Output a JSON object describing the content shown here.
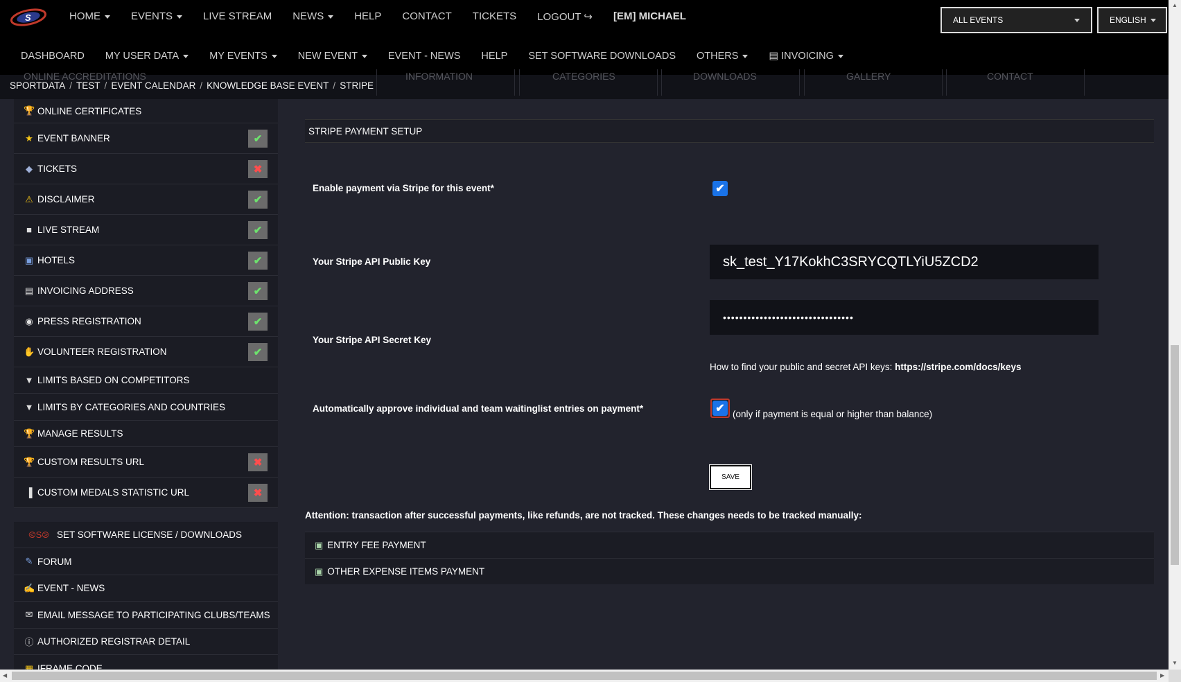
{
  "topnav": {
    "items": [
      "HOME",
      "EVENTS",
      "LIVE STREAM",
      "NEWS",
      "HELP",
      "CONTACT",
      "TICKETS",
      "LOGOUT"
    ],
    "user": "[EM] MICHAEL",
    "event_select": "ALL EVENTS",
    "language_select": "ENGLISH"
  },
  "subnav": {
    "items": [
      "DASHBOARD",
      "MY USER DATA",
      "MY EVENTS",
      "NEW EVENT",
      "EVENT - NEWS",
      "HELP",
      "SET SOFTWARE DOWNLOADS",
      "OTHERS",
      "INVOICING"
    ]
  },
  "ghost_tabs": [
    "ONLINE ACCREDITATIONS",
    "INFORMATION",
    "CATEGORIES",
    "DOWNLOADS",
    "GALLERY",
    "CONTACT"
  ],
  "breadcrumb": [
    "SPORTDATA",
    "TEST",
    "EVENT CALENDAR",
    "KNOWLEDGE BASE EVENT",
    "STRIPE"
  ],
  "sidebar": {
    "items": [
      {
        "label": "ONLINE CERTIFICATES",
        "icon": "trophy-icon",
        "status": ""
      },
      {
        "label": "EVENT BANNER",
        "icon": "star-icon",
        "status": "ok"
      },
      {
        "label": "TICKETS",
        "icon": "tag-icon",
        "status": "missing"
      },
      {
        "label": "DISCLAIMER",
        "icon": "warning-icon",
        "status": "ok"
      },
      {
        "label": "LIVE STREAM",
        "icon": "video-icon",
        "status": "ok"
      },
      {
        "label": "HOTELS",
        "icon": "suitcase-icon",
        "status": "ok"
      },
      {
        "label": "INVOICING ADDRESS",
        "icon": "document-icon",
        "status": "ok"
      },
      {
        "label": "PRESS REGISTRATION",
        "icon": "camera-icon",
        "status": "ok"
      },
      {
        "label": "VOLUNTEER REGISTRATION",
        "icon": "hand-icon",
        "status": "ok"
      },
      {
        "label": "LIMITS BASED ON COMPETITORS",
        "icon": "filter-icon",
        "status": ""
      },
      {
        "label": "LIMITS BY CATEGORIES AND COUNTRIES",
        "icon": "filter-icon",
        "status": ""
      },
      {
        "label": "MANAGE RESULTS",
        "icon": "trophy-icon",
        "status": ""
      },
      {
        "label": "CUSTOM RESULTS URL",
        "icon": "trophy-icon",
        "status": "missing"
      },
      {
        "label": "CUSTOM MEDALS STATISTIC URL",
        "icon": "bar-chart-icon",
        "status": "missing"
      }
    ],
    "items2": [
      {
        "label": "SET SOFTWARE LICENSE / DOWNLOADS",
        "icon": "sportdata-logo-icon"
      },
      {
        "label": "FORUM",
        "icon": "forum-icon"
      },
      {
        "label": "EVENT - NEWS",
        "icon": "news-icon"
      },
      {
        "label": "EMAIL MESSAGE TO PARTICIPATING CLUBS/TEAMS",
        "icon": "envelope-icon"
      },
      {
        "label": "AUTHORIZED REGISTRAR DETAIL",
        "icon": "info-icon"
      },
      {
        "label": "IFRAME CODE",
        "icon": "code-icon"
      }
    ]
  },
  "stripe": {
    "header": "STRIPE PAYMENT SETUP",
    "enable_label": "Enable payment via Stripe for this event*",
    "enable_checked": true,
    "public_key_label": "Your Stripe API Public Key",
    "public_key_value": "sk_test_Y17KokhC3SRYCQTLYiU5ZCD2",
    "secret_key_label": "Your Stripe API Secret Key",
    "secret_key_value": "••••••••••••••••••••••••••••••••",
    "help_text": "How to find your public and secret API keys:",
    "help_link": "https://stripe.com/docs/keys",
    "auto_approve_label": "Automatically approve individual and team waitinglist entries on payment*",
    "auto_approve_checked": true,
    "auto_approve_note": "(only if payment is equal or higher than balance)",
    "save_label": "SAVE",
    "attention": "Attention: transaction after successful payments, like refunds, are not tracked. These changes needs to be tracked manually:",
    "payments": [
      "ENTRY FEE PAYMENT",
      "OTHER EXPENSE ITEMS PAYMENT"
    ]
  },
  "colors": {
    "background": "#22232d",
    "bar": "#000000",
    "checkbox": "#1a73e8",
    "ok": "#6de26d",
    "missing": "#ff4d4d"
  }
}
